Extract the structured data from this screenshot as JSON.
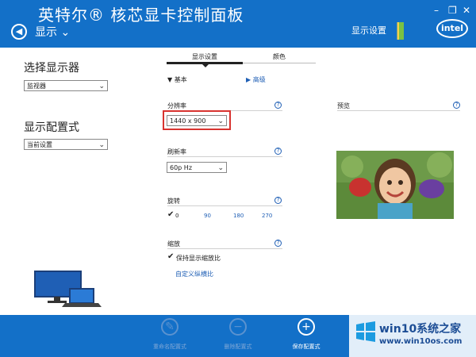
{
  "header": {
    "app_title": "英特尔® 核芯显卡控制面板",
    "section_title": "显示 ⌄",
    "right_tab": "显示设置",
    "win_minimize": "–",
    "win_restore": "❐",
    "win_close": "✕",
    "intel_logo": "intel"
  },
  "left": {
    "select_display_label": "选择显示器",
    "select_display_value": "监视器",
    "display_config_label": "显示配置式",
    "display_config_value": "当前设置"
  },
  "tabs": [
    {
      "label": "显示设置",
      "active": true
    },
    {
      "label": "颜色",
      "active": false
    }
  ],
  "mode": {
    "basic": "▼ 基本",
    "advanced": "▶ 高级"
  },
  "resolution": {
    "label": "分辨率",
    "value": "1440 x 900"
  },
  "refresh": {
    "label": "刷新率",
    "value": "60p Hz"
  },
  "rotation": {
    "label": "旋转",
    "options": [
      "0",
      "90",
      "180",
      "270"
    ],
    "selected": "0"
  },
  "scaling": {
    "label": "缩放",
    "keep_ratio": "保持显示缩放比",
    "custom_ratio": "自定义纵横比"
  },
  "preview": {
    "label": "预览"
  },
  "actions": [
    {
      "label": "重命名配置式",
      "icon": "pencil-icon",
      "enabled": false
    },
    {
      "label": "删除配置式",
      "icon": "minus-icon",
      "enabled": false
    },
    {
      "label": "保存配置式",
      "icon": "plus-icon",
      "enabled": true
    }
  ],
  "watermark": {
    "line1": "win10系统之家",
    "line2": "www.win10os.com"
  },
  "colors": {
    "header_blue": "#1370c8",
    "link_blue": "#1f5fb5",
    "highlight_red": "#d8332f"
  }
}
